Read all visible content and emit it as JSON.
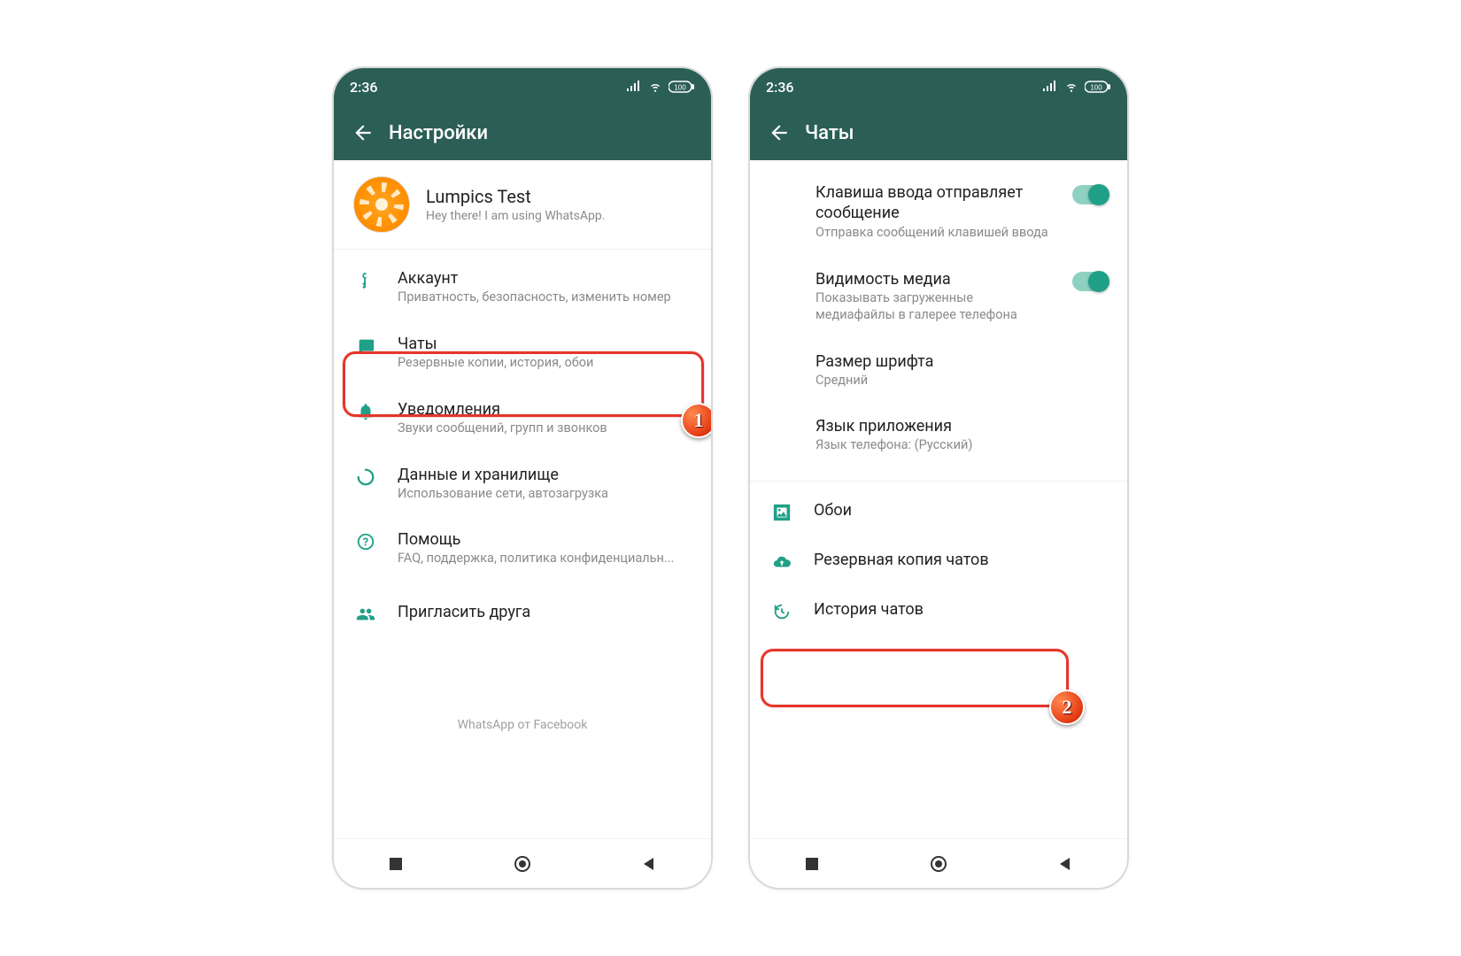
{
  "status": {
    "time": "2:36",
    "battery": "100"
  },
  "left": {
    "appbar_title": "Настройки",
    "profile": {
      "name": "Lumpics Test",
      "status": "Hey there! I am using WhatsApp."
    },
    "items": [
      {
        "title": "Аккаунт",
        "sub": "Приватность, безопасность, изменить номер"
      },
      {
        "title": "Чаты",
        "sub": "Резервные копии, история, обои"
      },
      {
        "title": "Уведомления",
        "sub": "Звуки сообщений, групп и звонков"
      },
      {
        "title": "Данные и хранилище",
        "sub": "Использование сети, автозагрузка"
      },
      {
        "title": "Помощь",
        "sub": "FAQ, поддержка, политика конфиденциальн..."
      },
      {
        "title": "Пригласить друга",
        "sub": ""
      }
    ],
    "footer": "WhatsApp от Facebook",
    "step_badge": "1"
  },
  "right": {
    "appbar_title": "Чаты",
    "items": [
      {
        "title": "Клавиша ввода отправляет сообщение",
        "sub": "Отправка сообщений клавишей ввода"
      },
      {
        "title": "Видимость медиа",
        "sub": "Показывать загруженные медиафайлы в галерее телефона"
      },
      {
        "title": "Размер шрифта",
        "sub": "Средний"
      },
      {
        "title": "Язык приложения",
        "sub": "Язык телефона: (Русский)"
      }
    ],
    "action_items": [
      {
        "title": "Обои"
      },
      {
        "title": "Резервная копия чатов"
      },
      {
        "title": "История чатов"
      }
    ],
    "step_badge": "2"
  }
}
